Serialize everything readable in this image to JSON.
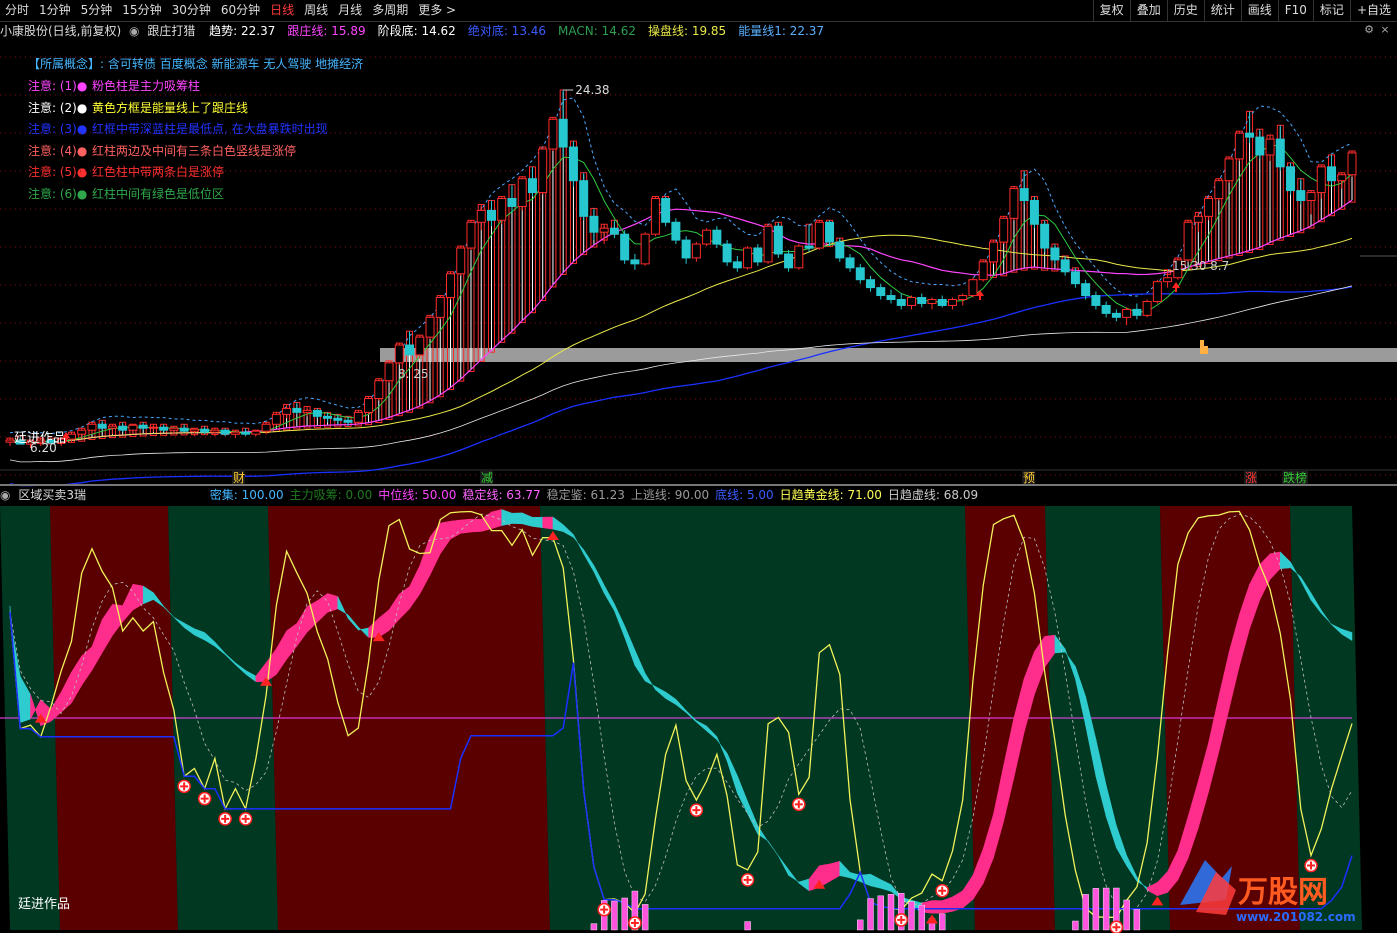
{
  "toolbar": {
    "periods": [
      "分时",
      "1分钟",
      "5分钟",
      "15分钟",
      "30分钟",
      "60分钟",
      "日线",
      "周线",
      "月线",
      "多周期",
      "更多 >"
    ],
    "active_period": "日线",
    "right_buttons": [
      "复权",
      "叠加",
      "历史",
      "统计",
      "画线",
      "F10",
      "标记",
      "+自选"
    ]
  },
  "main_panel": {
    "stock_title": "小康股份(日线,前复权)",
    "indicator_name": "跟庄打猎",
    "values": [
      {
        "label": "趋势: 22.37",
        "color": "#ffffff"
      },
      {
        "label": "跟庄线: 15.89",
        "color": "#ff44ff"
      },
      {
        "label": "阶段底: 14.62",
        "color": "#ffffff"
      },
      {
        "label": "绝对底: 13.46",
        "color": "#3a5bff"
      },
      {
        "label": "MACN: 14.62",
        "color": "#2e9e52"
      },
      {
        "label": "操盘线: 19.85",
        "color": "#e8e84a"
      },
      {
        "label": "能量线1: 22.37",
        "color": "#5ab0ff"
      }
    ],
    "concept_label": "【所属概念】:",
    "concept_text": "含可转债 百度概念 新能源车 无人驾驶 地摊经济",
    "notes": [
      {
        "label": "注意: (1)●",
        "text": "粉色柱是主力吸筹柱",
        "color": "#ff44ff"
      },
      {
        "label": "注意: (2)●",
        "text": "黄色方框是能量线上了跟庄线",
        "color": "#ffff33"
      },
      {
        "label": "注意: (3)●",
        "text": "红框中带深蓝柱是最低点, 在大盘暴跌时出现",
        "color": "#2233ff"
      },
      {
        "label": "注意: (4)●",
        "text": "红柱两边及中间有三条白色竖线是涨停",
        "color": "#ff6060"
      },
      {
        "label": "注意: (5)●",
        "text": "红色柱中带两条白是涨停",
        "color": "#ff3030"
      },
      {
        "label": "注意: (6)●",
        "text": "红柱中间有绿色是低位区",
        "color": "#2ea84a"
      }
    ],
    "annotations": {
      "high_label": "24.38",
      "low_label": "6.20",
      "watermark": "廷进作品",
      "mid_label1": "8.  25",
      "mid_label2": "15.30  8.7",
      "signals": [
        "财",
        "减",
        "预",
        "涨",
        "跌榜"
      ]
    }
  },
  "sub_panel": {
    "name": "区域买卖3瑞",
    "values": [
      {
        "label": "密集: 100.00",
        "color": "#45b6ff"
      },
      {
        "label": "主力吸筹: 0.00",
        "color": "#1f7a1f"
      },
      {
        "label": "中位线: 50.00",
        "color": "#ff44ff"
      },
      {
        "label": "稳定线: 63.77",
        "color": "#ff66ff"
      },
      {
        "label": "稳定鉴: 61.23",
        "color": "#9a9a9a"
      },
      {
        "label": "上逃线: 90.00",
        "color": "#9a9a9a"
      },
      {
        "label": "底线: 5.00",
        "color": "#3a5bff"
      },
      {
        "label": "日趋黄金线: 71.00",
        "color": "#ffff55"
      },
      {
        "label": "日趋虚线: 68.09",
        "color": "#cccccc"
      }
    ],
    "watermark": "廷进作品",
    "logo_text": "万股网",
    "logo_url_text": "www.201082.com"
  },
  "colors": {
    "up": "#ff2a2a",
    "down": "#27c7d0",
    "zone_red": "#5a0000",
    "zone_green": "#003822",
    "ribbon_pink": "#ff2d8c",
    "ribbon_cyan": "#2ecbcf",
    "yellow_line": "#f2f25a",
    "blue_line": "#1a30ff"
  },
  "chart_data": {
    "type": "candlestick",
    "price_range": [
      6.2,
      24.38
    ],
    "ohlc": [
      [
        6.6,
        6.8,
        6.4,
        6.7
      ],
      [
        6.7,
        6.9,
        6.5,
        6.5
      ],
      [
        6.5,
        6.7,
        6.3,
        6.6
      ],
      [
        6.6,
        6.8,
        6.4,
        6.7
      ],
      [
        6.7,
        6.8,
        6.5,
        6.55
      ],
      [
        6.55,
        6.8,
        6.4,
        6.75
      ],
      [
        6.75,
        7.1,
        6.6,
        7.0
      ],
      [
        7.0,
        7.3,
        6.8,
        7.2
      ],
      [
        7.2,
        7.6,
        7.0,
        7.5
      ],
      [
        7.5,
        7.7,
        7.2,
        7.3
      ],
      [
        7.3,
        7.5,
        7.0,
        7.4
      ],
      [
        7.4,
        7.6,
        7.1,
        7.2
      ],
      [
        7.2,
        7.5,
        7.0,
        7.45
      ],
      [
        7.45,
        7.6,
        7.2,
        7.3
      ],
      [
        7.3,
        7.5,
        7.1,
        7.35
      ],
      [
        7.35,
        7.5,
        7.1,
        7.2
      ],
      [
        7.2,
        7.4,
        7.0,
        7.3
      ],
      [
        7.3,
        7.5,
        7.1,
        7.15
      ],
      [
        7.15,
        7.3,
        6.9,
        7.25
      ],
      [
        7.25,
        7.4,
        7.0,
        7.1
      ],
      [
        7.1,
        7.3,
        6.9,
        7.2
      ],
      [
        7.2,
        7.3,
        6.9,
        7.0
      ],
      [
        7.0,
        7.2,
        6.8,
        7.1
      ],
      [
        7.1,
        7.3,
        6.9,
        7.0
      ],
      [
        7.0,
        7.2,
        6.9,
        7.15
      ],
      [
        7.15,
        7.6,
        7.0,
        7.5
      ],
      [
        7.5,
        8.1,
        7.4,
        8.0
      ],
      [
        8.0,
        8.5,
        7.8,
        8.3
      ],
      [
        8.3,
        8.6,
        8.0,
        8.1
      ],
      [
        8.1,
        8.4,
        7.9,
        8.2
      ],
      [
        8.2,
        8.3,
        7.8,
        7.9
      ],
      [
        7.9,
        8.1,
        7.6,
        7.8
      ],
      [
        7.8,
        8.0,
        7.5,
        7.7
      ],
      [
        7.7,
        7.9,
        7.4,
        7.6
      ],
      [
        7.6,
        8.2,
        7.5,
        8.1
      ],
      [
        8.1,
        8.9,
        8.0,
        8.8
      ],
      [
        8.8,
        9.8,
        8.7,
        9.7
      ],
      [
        9.7,
        10.7,
        9.6,
        10.6
      ],
      [
        10.6,
        11.6,
        10.5,
        11.5
      ],
      [
        11.5,
        12.2,
        11.0,
        11.0
      ],
      [
        11.0,
        12.0,
        10.8,
        11.9
      ],
      [
        11.9,
        13.0,
        11.8,
        12.9
      ],
      [
        12.9,
        14.0,
        12.8,
        13.9
      ],
      [
        13.9,
        15.2,
        13.8,
        15.1
      ],
      [
        15.1,
        16.5,
        15.0,
        16.4
      ],
      [
        16.4,
        17.8,
        16.3,
        17.7
      ],
      [
        17.7,
        18.6,
        17.3,
        18.3
      ],
      [
        18.3,
        18.8,
        17.5,
        17.8
      ],
      [
        17.8,
        19.0,
        17.6,
        18.9
      ],
      [
        18.9,
        19.6,
        18.2,
        18.5
      ],
      [
        18.5,
        20.0,
        18.3,
        19.9
      ],
      [
        19.9,
        20.5,
        19.0,
        19.2
      ],
      [
        19.2,
        21.5,
        19.1,
        21.4
      ],
      [
        21.4,
        23.0,
        21.3,
        22.9
      ],
      [
        22.9,
        24.38,
        21.0,
        21.5
      ],
      [
        21.5,
        21.8,
        19.5,
        19.8
      ],
      [
        19.8,
        20.2,
        17.8,
        18.0
      ],
      [
        18.0,
        18.4,
        16.8,
        17.2
      ],
      [
        17.2,
        17.6,
        16.6,
        17.4
      ],
      [
        17.4,
        17.8,
        16.9,
        17.1
      ],
      [
        17.1,
        17.3,
        15.6,
        15.8
      ],
      [
        15.8,
        16.1,
        15.3,
        15.6
      ],
      [
        15.6,
        17.2,
        15.5,
        17.1
      ],
      [
        17.1,
        19.0,
        17.0,
        18.9
      ],
      [
        18.9,
        19.0,
        17.5,
        17.7
      ],
      [
        17.7,
        17.9,
        16.6,
        16.8
      ],
      [
        16.8,
        17.0,
        15.6,
        15.9
      ],
      [
        15.9,
        16.7,
        15.7,
        16.6
      ],
      [
        16.6,
        17.4,
        16.5,
        17.3
      ],
      [
        17.3,
        17.5,
        16.4,
        16.6
      ],
      [
        16.6,
        16.8,
        15.5,
        15.7
      ],
      [
        15.7,
        16.0,
        15.2,
        15.4
      ],
      [
        15.4,
        16.5,
        15.3,
        16.4
      ],
      [
        16.4,
        16.6,
        15.5,
        15.7
      ],
      [
        15.7,
        17.6,
        15.6,
        17.5
      ],
      [
        17.5,
        17.7,
        15.9,
        16.1
      ],
      [
        16.1,
        16.3,
        15.2,
        15.4
      ],
      [
        15.4,
        16.6,
        15.3,
        16.5
      ],
      [
        16.5,
        17.6,
        16.2,
        16.4
      ],
      [
        16.4,
        17.8,
        16.3,
        17.7
      ],
      [
        17.7,
        17.8,
        16.5,
        16.7
      ],
      [
        16.7,
        16.9,
        15.7,
        15.9
      ],
      [
        15.9,
        16.1,
        15.2,
        15.4
      ],
      [
        15.4,
        15.6,
        14.6,
        14.8
      ],
      [
        14.8,
        15.0,
        14.2,
        14.4
      ],
      [
        14.4,
        14.6,
        13.8,
        14.0
      ],
      [
        14.0,
        14.3,
        13.6,
        13.8
      ],
      [
        13.8,
        14.1,
        13.3,
        13.5
      ],
      [
        13.5,
        14.0,
        13.3,
        13.9
      ],
      [
        13.9,
        14.1,
        13.4,
        13.6
      ],
      [
        13.6,
        13.9,
        13.3,
        13.8
      ],
      [
        13.8,
        14.0,
        13.4,
        13.5
      ],
      [
        13.5,
        13.9,
        13.3,
        13.8
      ],
      [
        13.8,
        14.1,
        13.5,
        14.0
      ],
      [
        14.0,
        14.9,
        13.9,
        14.8
      ],
      [
        14.8,
        15.8,
        14.7,
        15.7
      ],
      [
        15.7,
        16.8,
        15.6,
        16.7
      ],
      [
        16.7,
        18.0,
        16.6,
        17.9
      ],
      [
        17.9,
        19.5,
        17.8,
        19.4
      ],
      [
        19.4,
        20.3,
        18.6,
        18.8
      ],
      [
        18.8,
        19.0,
        17.4,
        17.6
      ],
      [
        17.6,
        17.8,
        16.2,
        16.4
      ],
      [
        16.4,
        16.6,
        15.6,
        15.8
      ],
      [
        15.8,
        16.0,
        15.0,
        15.2
      ],
      [
        15.2,
        15.4,
        14.4,
        14.6
      ],
      [
        14.6,
        14.8,
        13.8,
        14.0
      ],
      [
        14.0,
        14.2,
        13.3,
        13.5
      ],
      [
        13.5,
        13.7,
        12.9,
        13.1
      ],
      [
        13.1,
        13.3,
        12.7,
        12.9
      ],
      [
        12.9,
        13.4,
        12.5,
        13.3
      ],
      [
        13.3,
        13.6,
        12.8,
        13.0
      ],
      [
        13.0,
        13.8,
        12.9,
        13.7
      ],
      [
        13.7,
        14.8,
        13.6,
        14.7
      ],
      [
        14.7,
        15.3,
        14.4,
        14.9
      ],
      [
        14.9,
        15.9,
        14.8,
        15.8
      ],
      [
        15.8,
        17.8,
        15.7,
        17.7
      ],
      [
        17.7,
        18.2,
        17.2,
        18.0
      ],
      [
        18.0,
        19.0,
        17.8,
        18.9
      ],
      [
        18.9,
        19.9,
        18.8,
        19.8
      ],
      [
        19.8,
        21.0,
        19.7,
        20.9
      ],
      [
        20.9,
        22.3,
        20.8,
        22.2
      ],
      [
        22.2,
        23.3,
        21.7,
        22.0
      ],
      [
        22.0,
        22.4,
        20.9,
        21.1
      ],
      [
        21.1,
        22.1,
        20.8,
        21.9
      ],
      [
        21.9,
        22.6,
        20.3,
        20.5
      ],
      [
        20.5,
        20.7,
        19.1,
        19.3
      ],
      [
        19.3,
        19.9,
        18.6,
        18.8
      ],
      [
        18.8,
        19.3,
        18.1,
        19.2
      ],
      [
        19.2,
        20.6,
        18.9,
        20.5
      ],
      [
        20.5,
        21.1,
        19.6,
        19.8
      ],
      [
        19.8,
        20.2,
        19.4,
        20.1
      ],
      [
        20.1,
        21.3,
        20.0,
        21.2
      ]
    ]
  }
}
